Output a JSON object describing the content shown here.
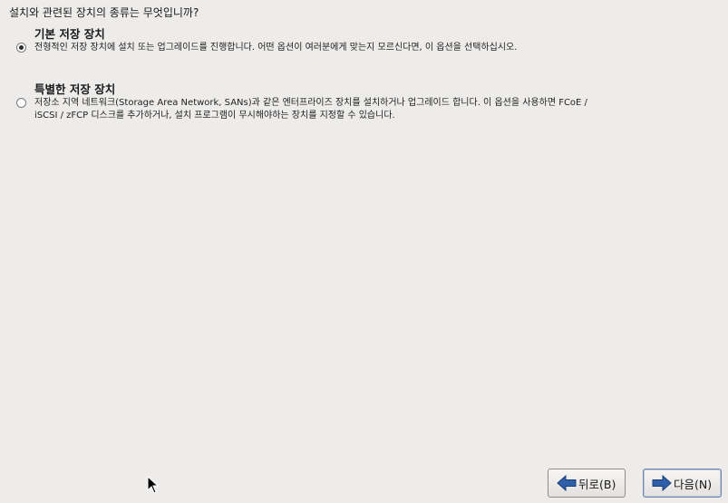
{
  "question": "설치와 관련된 장치의 종류는 무엇입니까?",
  "options": [
    {
      "title": "기본 저장 장치",
      "description": "전형적인 저장 장치에 설치 또는 업그레이드를 진행합니다. 어떤 옵션이 여러분에게 맞는지 모르신다면, 이 옵션을 선택하십시오.",
      "selected": true
    },
    {
      "title": "특별한 저장 장치",
      "description": "저장소 지역 네트워크(Storage Area Network, SANs)과 같은 엔터프라이즈 장치를 설치하거나 업그레이드 합니다. 이 옵션을 사용하면 FCoE / iSCSI / zFCP 디스크를 추가하거나, 설치 프로그램이 무시해야하는 장치를 지정할 수 있습니다.",
      "selected": false
    }
  ],
  "buttons": {
    "back_label": "뒤로(B)",
    "back_icon": "arrow-left-icon",
    "next_label": "다음(N)",
    "next_icon": "arrow-right-icon"
  },
  "colors": {
    "background": "#edeceb",
    "arrow_blue": "#2f5fa8"
  }
}
